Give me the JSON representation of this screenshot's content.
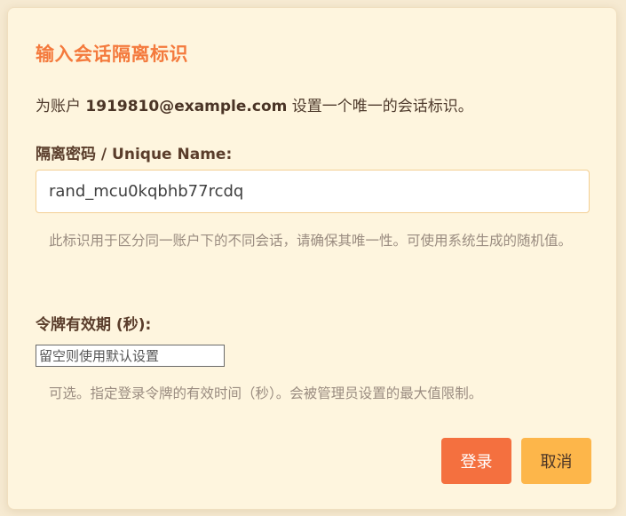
{
  "dialog": {
    "title": "输入会话隔离标识",
    "description_prefix": "为账户 ",
    "account": "1919810@example.com",
    "description_suffix": " 设置一个唯一的会话标识。",
    "name_field": {
      "label": "隔离密码 / Unique Name:",
      "value": "rand_mcu0kqbhb77rcdq",
      "hint": "此标识用于区分同一账户下的不同会话，请确保其唯一性。可使用系统生成的随机值。"
    },
    "ttl_field": {
      "label": "令牌有效期 (秒):",
      "value": "",
      "placeholder": "留空则使用默认设置",
      "hint": "可选。指定登录令牌的有效时间（秒）。会被管理员设置的最大值限制。"
    },
    "buttons": {
      "login": "登录",
      "cancel": "取消"
    }
  },
  "colors": {
    "accent": "#f47a3d",
    "primary_button": "#f4703f",
    "secondary_button": "#fdb64a",
    "dialog_bg": "#fef5de"
  }
}
